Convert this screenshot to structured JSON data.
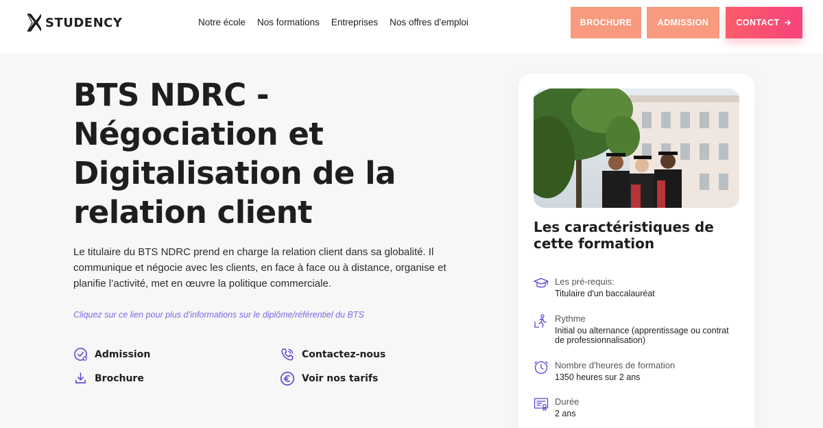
{
  "brand": {
    "name": "STUDENCY"
  },
  "nav": [
    "Notre école",
    "Nos formations",
    "Entreprises",
    "Nos offres d'emploi"
  ],
  "header_buttons": {
    "brochure": "BROCHURE",
    "admission": "ADMISSION",
    "contact": "CONTACT"
  },
  "hero": {
    "title": "BTS NDRC - Négociation et Digitalisation de la relation client",
    "description": "Le titulaire du BTS NDRC prend en charge la relation client dans sa globalité. Il communique et négocie avec les clients, en face à face ou à distance, organise et planifie l’activité, met en œuvre la politique commerciale.",
    "link": "Cliquez sur ce lien pour plus d’informations sur le diplôme/référentiel du BTS"
  },
  "actions": {
    "admission": "Admission",
    "brochure": "Brochure",
    "contact": "Contactez-nous",
    "tarifs": "Voir nos tarifs"
  },
  "card": {
    "title": "Les caractéristiques de cette formation",
    "features": [
      {
        "icon": "graduation-cap-icon",
        "label": "Les pré-requis:",
        "value": "Titulaire d'un baccalauréat"
      },
      {
        "icon": "person-rhythm-icon",
        "label": "Rythme",
        "value": "Initial ou alternance (apprentissage ou contrat de professionnalisation)"
      },
      {
        "icon": "clock-icon",
        "label": "Nombre d'heures de formation",
        "value": "1350 heures sur 2 ans"
      },
      {
        "icon": "certificate-icon",
        "label": "Durée",
        "value": "2 ans"
      }
    ]
  },
  "colors": {
    "accent_coral": "#f79a7f",
    "accent_pink": "#f7437a",
    "link_purple": "#7b68e6",
    "icon_purple": "#5b3fd6"
  }
}
